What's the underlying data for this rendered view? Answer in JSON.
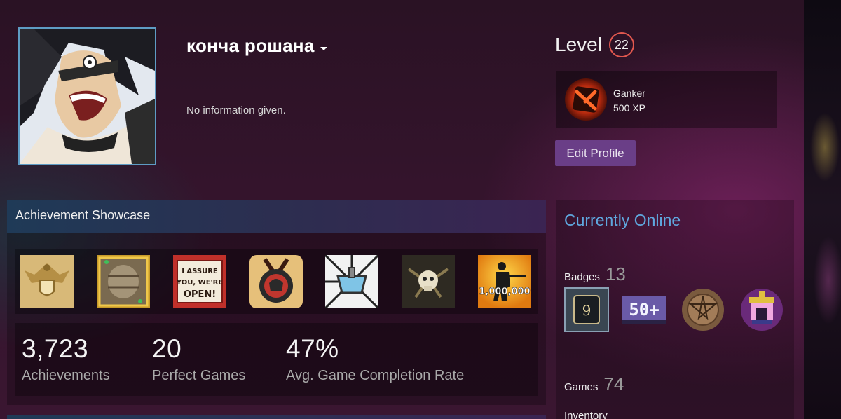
{
  "profile": {
    "persona_name": "кончa рошана",
    "summary": "No information given."
  },
  "level": {
    "label": "Level",
    "value": "22"
  },
  "favorite_badge": {
    "name": "Ganker",
    "xp": "500 XP"
  },
  "edit_profile_label": "Edit Profile",
  "showcase": {
    "title": "Achievement Showcase",
    "achievements": [
      {
        "icon": "eagle-shield-icon"
      },
      {
        "icon": "barrel-icon"
      },
      {
        "icon": "sign-icon",
        "text": "I ASSURE YOU, WE'RE OPEN!"
      },
      {
        "icon": "medal-icon"
      },
      {
        "icon": "sink-icon"
      },
      {
        "icon": "skull-icon"
      },
      {
        "icon": "soldier-icon",
        "text": "1,000,000"
      }
    ],
    "stats": [
      {
        "value": "3,723",
        "label": "Achievements"
      },
      {
        "value": "20",
        "label": "Perfect Games"
      },
      {
        "value": "47%",
        "label": "Avg. Game Completion Rate"
      }
    ]
  },
  "sidebar": {
    "status": "Currently Online",
    "badges_label": "Badges",
    "badges_count": "13",
    "badges": [
      {
        "icon": "badge-level-9-icon",
        "text": "9"
      },
      {
        "icon": "badge-50-plus-icon",
        "text": "50+"
      },
      {
        "icon": "pentagram-coin-icon"
      },
      {
        "icon": "pixel-castle-icon"
      }
    ],
    "games_label": "Games",
    "games_count": "74",
    "inventory_label": "Inventory"
  },
  "colors": {
    "level_ring": "#e2584f",
    "online": "#5fa7de",
    "edit_button": "#6a3e87",
    "avatar_border": "#5e9cc4"
  }
}
